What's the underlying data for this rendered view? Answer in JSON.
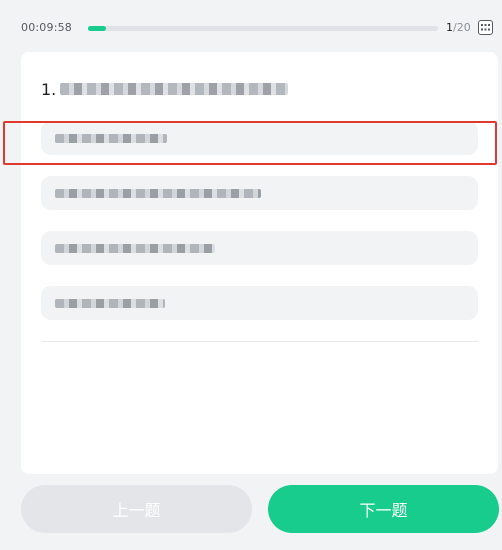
{
  "header": {
    "timer": "00:09:58",
    "progress_fraction": 0.05,
    "counter_current": "1",
    "counter_total": "/20",
    "grid_icon": "grid-icon"
  },
  "question": {
    "number_prefix": "1."
  },
  "options": [
    {
      "id": "A",
      "selected": false
    },
    {
      "id": "B",
      "selected": true
    },
    {
      "id": "C",
      "selected": false
    },
    {
      "id": "D",
      "selected": false
    }
  ],
  "footer": {
    "prev_label": "上一题",
    "next_label": "下一题"
  },
  "colors": {
    "accent": "#17cc8c",
    "highlight": "#e0392e",
    "disabled": "#e3e5e8"
  }
}
